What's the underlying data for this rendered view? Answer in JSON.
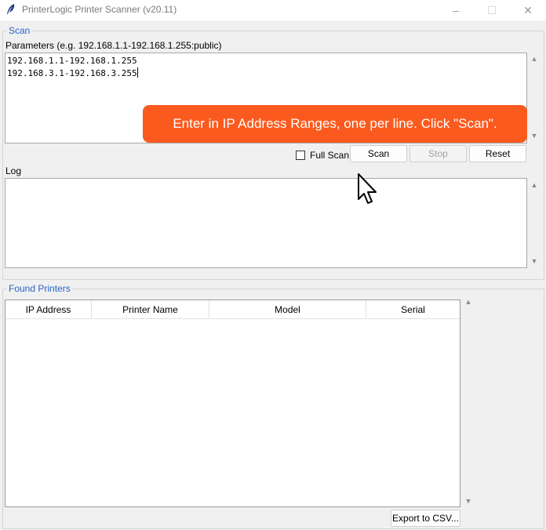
{
  "window": {
    "title": "PrinterLogic Printer Scanner (v20.11)",
    "icon": "feather-icon",
    "controls": {
      "minimize": "–",
      "maximize": "☐",
      "close": "✕"
    }
  },
  "scan": {
    "frame_label": "Scan",
    "parameters_label": "Parameters  (e.g. 192.168.1.1-192.168.1.255:public)",
    "ranges": [
      "192.168.1.1-192.168.1.255",
      "192.168.3.1-192.168.3.255"
    ],
    "full_scan_label": "Full Scan",
    "full_scan_checked": false,
    "scan_button": "Scan",
    "stop_button": "Stop",
    "reset_button": "Reset"
  },
  "log": {
    "label": "Log"
  },
  "found_printers": {
    "frame_label": "Found Printers",
    "columns": [
      "IP Address",
      "Printer Name",
      "Model",
      "Serial"
    ],
    "rows": [],
    "export_button": "Export to CSV..."
  },
  "tooltip": {
    "text": "Enter in IP Address Ranges, one per line. Click \"Scan\".",
    "color": "#fb5a1e"
  },
  "scroll_arrows": {
    "up": "▲",
    "down": "▼"
  }
}
